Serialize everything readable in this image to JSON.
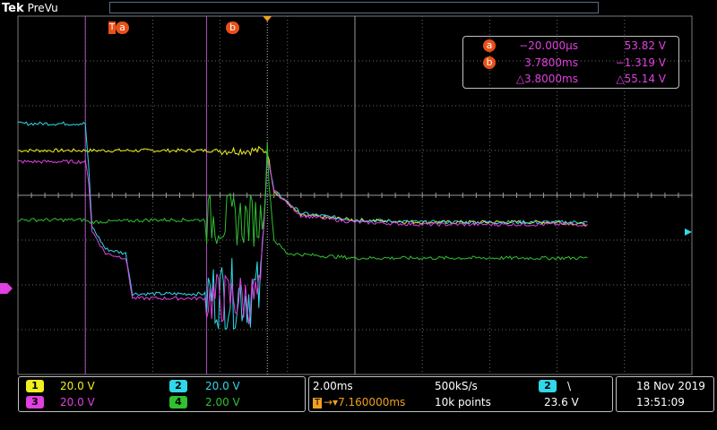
{
  "app": {
    "brand": "Tek",
    "mode": "PreVu"
  },
  "cursors": {
    "a": {
      "label": "a",
      "time": "−20.000µs",
      "value": "53.82 V"
    },
    "b": {
      "label": "b",
      "time": "3.7800ms",
      "value": "−1.319 V"
    },
    "delta": {
      "time": "△3.8000ms",
      "value": "△55.14 V"
    }
  },
  "trigger_marker": {
    "label": "T"
  },
  "channels": [
    {
      "id": "1",
      "scale": "20.0 V",
      "color": "#f0f020"
    },
    {
      "id": "3",
      "scale": "20.0 V",
      "color": "#e040e0"
    },
    {
      "id": "2",
      "scale": "20.0 V",
      "color": "#30d8e8"
    },
    {
      "id": "4",
      "scale": "2.00 V",
      "color": "#30c030"
    }
  ],
  "timebase": {
    "scale": "2.00ms",
    "sample_rate": "500kS/s",
    "trigger_label": "T",
    "position": "→▾7.160000ms",
    "record_length": "10k points"
  },
  "trigger": {
    "source": "2",
    "slope": "\\",
    "level": "23.6 V"
  },
  "clock": {
    "date": "18 Nov 2019",
    "time": "13:51:09"
  },
  "colors": {
    "grid": "#6a6a6a",
    "accent": "#e8501a",
    "panel_border": "#c0c0c0",
    "trigger_orange": "#f0a020"
  },
  "chart_data": {
    "type": "line",
    "title": "",
    "xlabel": "",
    "ylabel": "",
    "x_divisions": 10,
    "y_divisions": 8,
    "xlim_div": [
      0,
      10
    ],
    "ylim_div": [
      -4,
      4
    ],
    "grid": true,
    "series": [
      {
        "name": "1",
        "channel": "1",
        "color": "#f0f020",
        "x": [
          0,
          1.0,
          1.05,
          2.0,
          2.8,
          3.6,
          3.7,
          3.8,
          4.2,
          5.0,
          6.0,
          7.0,
          8.0,
          8.45
        ],
        "y": [
          1.0,
          1.0,
          1.0,
          1.0,
          1.0,
          1.0,
          1.0,
          0.1,
          -0.45,
          -0.55,
          -0.6,
          -0.6,
          -0.6,
          -0.65
        ]
      },
      {
        "name": "2",
        "channel": "2",
        "color": "#30d8e8",
        "x": [
          0,
          1.0,
          1.05,
          1.1,
          1.3,
          1.6,
          1.7,
          2.0,
          2.7,
          2.8,
          3.6,
          3.7,
          3.8,
          4.2,
          5.0,
          6.0,
          7.0,
          8.0,
          8.45
        ],
        "y": [
          1.6,
          1.6,
          0.6,
          -0.7,
          -1.2,
          -1.3,
          -2.2,
          -2.2,
          -2.2,
          -2.2,
          -2.2,
          0.9,
          0.1,
          -0.4,
          -0.55,
          -0.6,
          -0.6,
          -0.6,
          -0.6
        ]
      },
      {
        "name": "3",
        "channel": "3",
        "color": "#e040e0",
        "x": [
          0,
          1.0,
          1.05,
          1.1,
          1.3,
          1.6,
          1.7,
          2.0,
          2.7,
          2.8,
          3.6,
          3.7,
          3.8,
          4.2,
          5.0,
          6.0,
          7.0,
          8.0,
          8.45
        ],
        "y": [
          0.75,
          0.75,
          0.3,
          -0.8,
          -1.3,
          -1.4,
          -2.3,
          -2.3,
          -2.3,
          -2.3,
          -2.3,
          0.9,
          0.1,
          -0.45,
          -0.6,
          -0.65,
          -0.65,
          -0.65,
          -0.65
        ]
      },
      {
        "name": "4",
        "channel": "4",
        "color": "#30c030",
        "x": [
          0,
          1.0,
          1.05,
          2.0,
          2.7,
          3.6,
          3.7,
          3.8,
          4.0,
          4.5,
          5.0,
          6.0,
          7.0,
          8.0,
          8.45
        ],
        "y": [
          -0.55,
          -0.55,
          -0.6,
          -0.55,
          -0.55,
          -0.55,
          0.7,
          -1.0,
          -1.3,
          -1.35,
          -1.4,
          -1.4,
          -1.4,
          -1.4,
          -1.4
        ]
      }
    ],
    "noise_bursts": [
      {
        "channel": "2",
        "x_range": [
          2.8,
          3.65
        ],
        "amplitude_div": 0.8
      },
      {
        "channel": "3",
        "x_range": [
          2.8,
          3.65
        ],
        "amplitude_div": 0.6
      },
      {
        "channel": "4",
        "x_range": [
          2.8,
          3.7
        ],
        "amplitude_div": 0.6
      },
      {
        "channel": "1",
        "x_range": [
          3.0,
          3.7
        ],
        "amplitude_div": 0.1
      }
    ],
    "cursor_lines_div": {
      "a": 1.0,
      "b": 2.8
    },
    "trigger_position_div": 3.7
  }
}
